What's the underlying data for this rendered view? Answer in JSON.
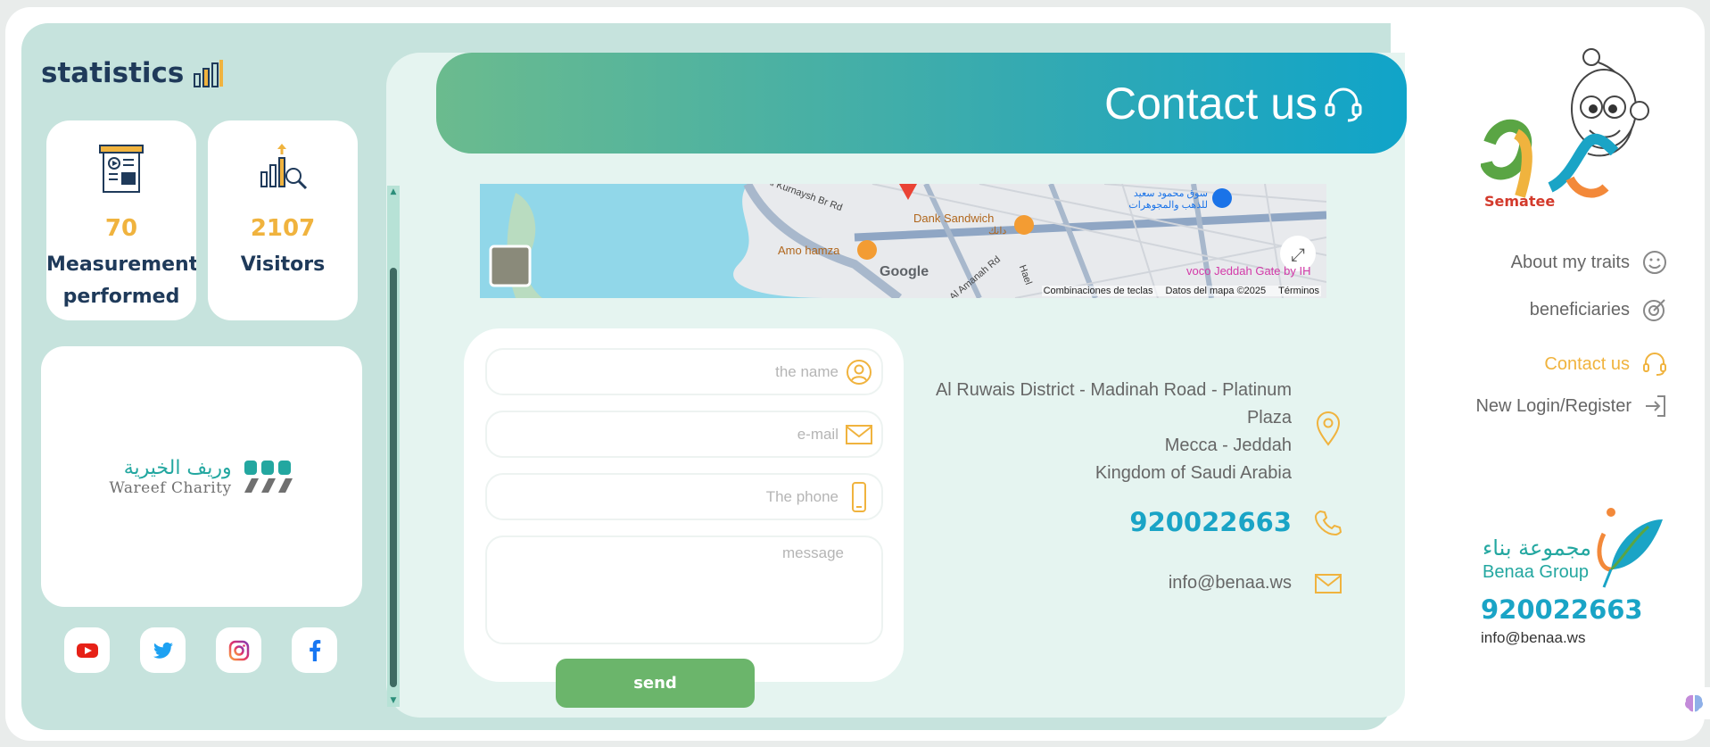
{
  "statistics": {
    "title": "statistics",
    "cards": [
      {
        "value": "70",
        "label_line1": "Measurement",
        "label_line2": "performed"
      },
      {
        "value": "2107",
        "label_line1": "Visitors"
      }
    ]
  },
  "charity": {
    "name_ar": "وريف الخيرية",
    "name_en": "Wareef Charity"
  },
  "social": [
    "youtube-icon",
    "twitter-icon",
    "instagram-icon",
    "facebook-icon"
  ],
  "header": {
    "title": "Contact us"
  },
  "map": {
    "labels": {
      "road1": "Al Kurnaysh Br Rd",
      "place1": "Dank Sandwich",
      "place1_ar": "دانك",
      "place2": "Amo hamza",
      "road2": "Al Amanah Rd",
      "road3": "Hael",
      "place3": "voco Jeddah Gate by IH",
      "place4_ar": "سوق محمود سعيد للذهب والمجوهرات",
      "google": "Google"
    },
    "footer": [
      "Combinaciones de teclas",
      "Datos del mapa ©2025",
      "Términos"
    ]
  },
  "form": {
    "name_placeholder": "the name",
    "email_placeholder": "e-mail",
    "phone_placeholder": "The phone",
    "message_placeholder": "message",
    "send_label": "send"
  },
  "contact": {
    "address_line1": "Al Ruwais District - Madinah Road - Platinum",
    "address_line2": "Plaza",
    "address_line3": "Mecca - Jeddah",
    "address_line4": "Kingdom of Saudi Arabia",
    "phone": "920022663",
    "email": "info@benaa.ws"
  },
  "sidebar": {
    "logo_text": "Sematee",
    "items": [
      {
        "label": "About my traits",
        "icon": "smile-icon"
      },
      {
        "label": "beneficiaries",
        "icon": "target-icon"
      },
      {
        "label": "Contact us",
        "icon": "headset-icon"
      },
      {
        "label": "New Login/Register",
        "icon": "login-icon"
      }
    ],
    "group_ar": "مجموعة بناء",
    "group_en": "Benaa Group",
    "phone": "920022663",
    "email": "info@benaa.ws"
  },
  "colors": {
    "accent_teal": "#1aa4c6",
    "accent_gold": "#f0b33e",
    "panel_bg": "#c6e3dd",
    "send_green": "#6bb56b",
    "navy": "#1f3a5a"
  }
}
